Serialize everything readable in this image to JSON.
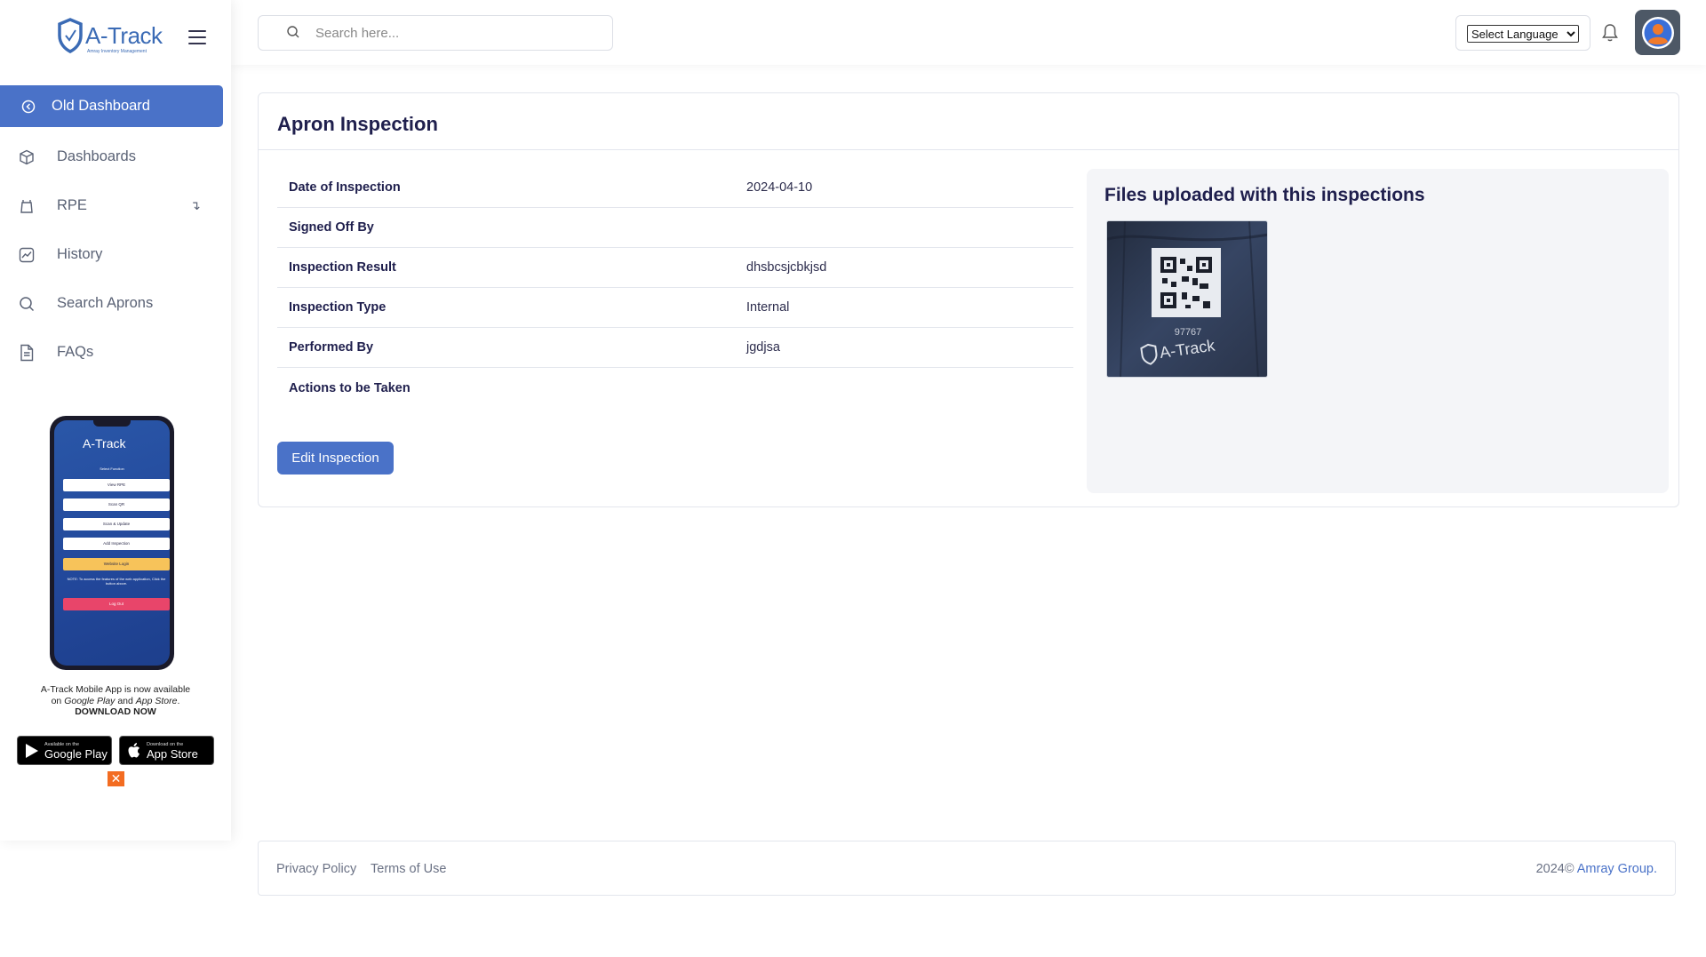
{
  "brand": {
    "name": "A-Track",
    "tagline": "Amray Inventory Management"
  },
  "search": {
    "placeholder": "Search here..."
  },
  "header": {
    "language_label": "Select Language"
  },
  "sidebar": {
    "items": [
      {
        "label": "Old Dashboard",
        "icon": "arrow-left-circle-icon"
      },
      {
        "label": "Dashboards",
        "icon": "cube-icon"
      },
      {
        "label": "RPE",
        "icon": "mask-icon",
        "arrow": "↴"
      },
      {
        "label": "History",
        "icon": "chart-icon"
      },
      {
        "label": "Search Aprons",
        "icon": "search-icon"
      },
      {
        "label": "FAQs",
        "icon": "document-icon"
      }
    ]
  },
  "promo": {
    "phone": {
      "title": "A-Track",
      "subtitle": "Select Function",
      "buttons": [
        "View RPE",
        "Scan QR",
        "Scan & Update",
        "Add Inspection",
        "Website Login",
        "Log Out"
      ],
      "note": "NOTE: To access the features of the web application, Click the button above."
    },
    "line1": "A-Track Mobile App is now available",
    "line2_prefix": "on ",
    "line2_google": "Google Play",
    "line2_and": " and ",
    "line2_apple": "App Store",
    "line2_suffix": ".",
    "cta": "DOWNLOAD NOW",
    "google_small": "Available on the",
    "google_big": "Google Play",
    "apple_small": "Download on the",
    "apple_big": "App Store",
    "close": "✕"
  },
  "card": {
    "title": "Apron Inspection",
    "rows": [
      {
        "label": "Date of Inspection",
        "value": "2024-04-10"
      },
      {
        "label": "Signed Off By",
        "value": ""
      },
      {
        "label": "Inspection Result",
        "value": "dhsbcsjcbkjsd"
      },
      {
        "label": "Inspection Type",
        "value": "Internal"
      },
      {
        "label": "Performed By",
        "value": "jgdjsa"
      },
      {
        "label": "Actions to be Taken",
        "value": ""
      }
    ],
    "edit_label": "Edit Inspection",
    "files_title": "Files uploaded with this inspections",
    "thumb_code": "97767",
    "thumb_brand": "A-Track"
  },
  "footer": {
    "privacy": "Privacy Policy",
    "terms": "Terms of Use",
    "year": "2024©",
    "company": "Amray Group."
  },
  "colors": {
    "accent": "#4a72c8",
    "title": "#1f1f4d",
    "close": "#f36c21"
  }
}
